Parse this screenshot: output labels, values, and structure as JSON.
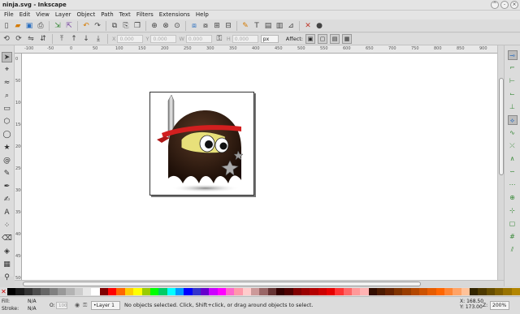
{
  "window": {
    "title": "ninja.svg - Inkscape",
    "buttons": [
      "^",
      "-",
      "×"
    ]
  },
  "menu": [
    "File",
    "Edit",
    "View",
    "Layer",
    "Object",
    "Path",
    "Text",
    "Filters",
    "Extensions",
    "Help"
  ],
  "toolbar": {
    "icons": [
      {
        "name": "new-document-icon",
        "glyph": "▯",
        "color": ""
      },
      {
        "name": "open-icon",
        "glyph": "▰",
        "color": "c-orn"
      },
      {
        "name": "save-icon",
        "glyph": "▣",
        "color": "c-blue"
      },
      {
        "name": "print-icon",
        "glyph": "⎙",
        "color": ""
      },
      {
        "name": "import-icon",
        "glyph": "⇲",
        "color": "c-green"
      },
      {
        "name": "export-icon",
        "glyph": "⇱",
        "color": "c-pur"
      },
      {
        "name": "undo-icon",
        "glyph": "↶",
        "color": "c-orn"
      },
      {
        "name": "redo-icon",
        "glyph": "↷",
        "color": ""
      },
      {
        "name": "copy-icon",
        "glyph": "⧉",
        "color": ""
      },
      {
        "name": "paste-icon",
        "glyph": "⎘",
        "color": ""
      },
      {
        "name": "duplicate-icon",
        "glyph": "❐",
        "color": ""
      },
      {
        "name": "zoom-selection-icon",
        "glyph": "⊕",
        "color": ""
      },
      {
        "name": "zoom-drawing-icon",
        "glyph": "⊗",
        "color": ""
      },
      {
        "name": "zoom-page-icon",
        "glyph": "⊙",
        "color": ""
      },
      {
        "name": "group-icon",
        "glyph": "⧈",
        "color": "c-blue"
      },
      {
        "name": "ungroup-icon",
        "glyph": "⧇",
        "color": ""
      },
      {
        "name": "clone-icon",
        "glyph": "⊞",
        "color": ""
      },
      {
        "name": "unlink-clone-icon",
        "glyph": "⊟",
        "color": ""
      },
      {
        "name": "xml-editor-icon",
        "glyph": "✎",
        "color": "c-orn"
      },
      {
        "name": "text-font-icon",
        "glyph": "T",
        "color": ""
      },
      {
        "name": "layers-icon",
        "glyph": "▤",
        "color": ""
      },
      {
        "name": "align-distribute-icon",
        "glyph": "▥",
        "color": ""
      },
      {
        "name": "transform-icon",
        "glyph": "⊿",
        "color": ""
      },
      {
        "name": "preferences-icon",
        "glyph": "✕",
        "color": "c-red"
      },
      {
        "name": "document-properties-icon",
        "glyph": "●",
        "color": ""
      }
    ]
  },
  "controls": {
    "x_label": "X",
    "x_value": "0.000",
    "y_label": "Y",
    "y_value": "0.000",
    "w_label": "W",
    "w_value": "0.000",
    "h_label": "H",
    "h_value": "0.000",
    "unit": "px",
    "affect_label": "Affect:"
  },
  "tools": [
    {
      "name": "selector-tool-icon",
      "glyph": "➤",
      "active": true
    },
    {
      "name": "node-tool-icon",
      "glyph": "⌖",
      "active": false
    },
    {
      "name": "tweak-tool-icon",
      "glyph": "≈",
      "active": false
    },
    {
      "name": "zoom-tool-icon",
      "glyph": "⌕",
      "active": false
    },
    {
      "name": "rect-tool-icon",
      "glyph": "▭",
      "active": false
    },
    {
      "name": "3dbox-tool-icon",
      "glyph": "⬡",
      "active": false
    },
    {
      "name": "ellipse-tool-icon",
      "glyph": "◯",
      "active": false
    },
    {
      "name": "star-tool-icon",
      "glyph": "★",
      "active": false
    },
    {
      "name": "spiral-tool-icon",
      "glyph": "@",
      "active": false
    },
    {
      "name": "pencil-tool-icon",
      "glyph": "✎",
      "active": false
    },
    {
      "name": "pen-tool-icon",
      "glyph": "✒",
      "active": false
    },
    {
      "name": "calligraphy-tool-icon",
      "glyph": "✍",
      "active": false
    },
    {
      "name": "text-tool-icon",
      "glyph": "A",
      "active": false
    },
    {
      "name": "spray-tool-icon",
      "glyph": "⁘",
      "active": false
    },
    {
      "name": "eraser-tool-icon",
      "glyph": "⌫",
      "active": false
    },
    {
      "name": "paint-bucket-tool-icon",
      "glyph": "◈",
      "active": false
    },
    {
      "name": "gradient-tool-icon",
      "glyph": "▦",
      "active": false
    },
    {
      "name": "dropper-tool-icon",
      "glyph": "⚲",
      "active": false
    }
  ],
  "snap": [
    {
      "name": "snap-enable-icon",
      "glyph": "⊸",
      "on": true
    },
    {
      "name": "snap-bbox-icon",
      "glyph": "⌐",
      "on": false
    },
    {
      "name": "snap-bbox-edge-icon",
      "glyph": "⊢",
      "on": false
    },
    {
      "name": "snap-bbox-corner-icon",
      "glyph": "⌙",
      "on": false
    },
    {
      "name": "snap-bbox-midpoint-icon",
      "glyph": "⊥",
      "on": false
    },
    {
      "name": "snap-nodes-icon",
      "glyph": "⟡",
      "on": true
    },
    {
      "name": "snap-paths-icon",
      "glyph": "∿",
      "on": false
    },
    {
      "name": "snap-path-intersection-icon",
      "glyph": "⤫",
      "on": false
    },
    {
      "name": "snap-cusp-icon",
      "glyph": "∧",
      "on": false
    },
    {
      "name": "snap-smooth-icon",
      "glyph": "∽",
      "on": false
    },
    {
      "name": "snap-midpoint-icon",
      "glyph": "⋯",
      "on": false
    },
    {
      "name": "snap-center-icon",
      "glyph": "⊕",
      "on": false
    },
    {
      "name": "snap-rotation-center-icon",
      "glyph": "⊹",
      "on": false
    },
    {
      "name": "snap-page-border-icon",
      "glyph": "▢",
      "on": false
    },
    {
      "name": "snap-grid-icon",
      "glyph": "#",
      "on": false
    },
    {
      "name": "snap-guide-icon",
      "glyph": "⫽",
      "on": false
    }
  ],
  "palette_colors": [
    "#000000",
    "#1a1a1a",
    "#333333",
    "#4d4d4d",
    "#666666",
    "#808080",
    "#999999",
    "#b3b3b3",
    "#cccccc",
    "#e6e6e6",
    "#ffffff",
    "#800000",
    "#ff0000",
    "#ff6600",
    "#ffcc00",
    "#ffff00",
    "#99cc00",
    "#00ff00",
    "#00cc66",
    "#00ffff",
    "#0099ff",
    "#0000ff",
    "#3333cc",
    "#6600cc",
    "#cc00ff",
    "#ff00ff",
    "#ff66cc",
    "#ff99aa",
    "#ffcccc",
    "#cc9999",
    "#996666",
    "#663333",
    "#330000",
    "#4d0000",
    "#800000",
    "#990000",
    "#b30000",
    "#cc0000",
    "#e60000",
    "#ff3333",
    "#ff6666",
    "#ff9999",
    "#ffb3b3",
    "#330d00",
    "#4d1a00",
    "#662200",
    "#803300",
    "#993d00",
    "#b34700",
    "#cc5200",
    "#e65c00",
    "#ff6600",
    "#ff8533",
    "#ffa366",
    "#ffc299",
    "#332600",
    "#4d3900",
    "#664d00",
    "#806000",
    "#997300",
    "#b38600"
  ],
  "rulers": {
    "h_ticks": [
      "-100",
      "-50",
      "0",
      "50",
      "100",
      "150",
      "200",
      "250",
      "300",
      "350",
      "400",
      "450",
      "500",
      "550",
      "600",
      "650",
      "700",
      "750",
      "800",
      "850",
      "900"
    ],
    "v_ticks": [
      "0",
      "50",
      "100",
      "150",
      "200",
      "250",
      "300",
      "350",
      "400",
      "450",
      "500"
    ]
  },
  "status": {
    "fill_label": "Fill:",
    "fill_value": "N/A",
    "stroke_label": "Stroke:",
    "stroke_value": "N/A",
    "opacity_label": "O:",
    "opacity_value": "100",
    "layer": "•Layer 1",
    "message": "No objects selected. Click, Shift+click, or drag around objects to select.",
    "x_label": "X:",
    "x_value": "168.50",
    "y_label": "Y:",
    "y_value": "173.00",
    "zoom_label": "Z:",
    "zoom_value": "200%"
  }
}
